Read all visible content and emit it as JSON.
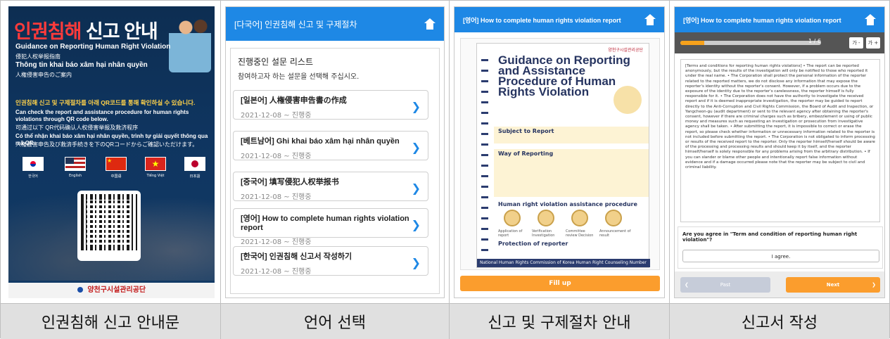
{
  "captions": [
    "인권침해 신고 안내문",
    "언어 선택",
    "신고 및 구제절차 안내",
    "신고서 작성"
  ],
  "poster": {
    "title_red": "인권침해",
    "title_white": "신고 안내",
    "en_title": "Guidance on Reporting Human Right Violation",
    "jp_title": "侵犯人权举报指南",
    "vi_title": "Thông tin khai báo xâm hại nhân quyền",
    "cn_title": "人権侵害申告のご案内",
    "qr_ko": "인권침해 신고 및 구제절차를 아래 QR코드를 통해 확인하실 수 있습니다.",
    "qr_en": "Can check the report and assistance procedure for human rights violations through QR code below.",
    "qr_cn": "可通过以下 QR代码确认人权侵害举报及救济程序",
    "qr_vi": "Có thể nhận khai báo xâm hại nhân quyền, trình tự giải quyết thông qua mã QR",
    "qr_jp": "人権侵害申告及び救済手続きを下のQRコードからご確認いただけます。",
    "flags": [
      "한국어",
      "English",
      "中国语",
      "Tiếng Việt",
      "日本語"
    ],
    "footer": "양천구시설관리공단"
  },
  "lang_select": {
    "header": "[다국어] 인권침해 신고 및 구제절차",
    "line1": "진행중인 설문 리스트",
    "line2": "참여하고자 하는 설문을 선택해 주십시오.",
    "surveys": [
      {
        "title": "[일본어] 人権侵害申告書の作成",
        "date": "2021-12-08 ~ 진행중"
      },
      {
        "title": "[베트남어] Ghi khai báo xâm hại nhân quyền",
        "date": "2021-12-08 ~ 진행중"
      },
      {
        "title": "[중국어] 填写侵犯人权举报书",
        "date": "2021-12-08 ~ 진행중"
      },
      {
        "title": "[영어] How to complete human rights violation report",
        "date": "2021-12-08 ~ 진행중"
      },
      {
        "title": "[한국어] 인권침해 신고서 작성하기",
        "date": "2021-12-08 ~ 진행중"
      }
    ]
  },
  "guide": {
    "header": "[영어] How to complete human rights violation report",
    "org": "양천구시설관리공단",
    "doc_title": "Guidance on Reporting and Assistance Procedure of Human Rights Violation",
    "subject": "Subject to Report",
    "way": "Way of Reporting",
    "assist": "Human right violation assistance procedure",
    "steps": [
      "Application of report",
      "Verification Investigation",
      "Committee review Decision",
      "Announcement of result"
    ],
    "protection": "Protection of reporter",
    "footer": "National Human Rights Commission of Korea Human Right Counseling Number Without area code 1331",
    "fill_up": "Fill up"
  },
  "form": {
    "header": "[영어] How to complete human rights violation report",
    "progress": "1 / 6",
    "progress_fraction": 0.17,
    "font_minus": "가 -",
    "font_plus": "가 +",
    "terms": "[Terms and conditions for reporting human rights violations] • The report can be reported anonymously, but the results of the investigation will only be notified to those who reported it under the real name. • The Corporation shall protect the personal information of the reporter related to the reported matters, we do not disclose any information that may expose the reporter's identity without the reporter's consent. However, if a problem occurs due to the exposure of the identity due to the reporter's carelessness, the reporter himself is fully responsible for it. • The Corporation does not have the authority to investigate the received report and if it is deemed inappropriate investigation, the reporter may be guided to report directly to the Anti-Corruption and Civil Rights Commission, the Board of Audit and Inspection, or Yangcheon-gu (audit department) or sent to the relevant agency after obtaining the reporter's consent, however if there are criminal charges such as bribery, embezzlement or using of public money and measures such as requesting an investigation or prosecution from investigative agency shall be taken. • After submitting the report, it is impossible to correct or erase the report, so please check whether information or unnecessary information related to the reporter is not included before submitting the report. • The Corporation is not obligated to inform processing or results of the received report to the reporter. Only the reporter himself/herself should be aware of the processing and processing results and should keep it by itself, and the reporter himself/herself is solely responsible for any problems arising from the arbitrary distribution. • If you can slander or blame other people and intentionally report false information without evidence and if a damage occurred please note that the reporter may be subject to civil and criminal liability.",
    "question": "Are you agree in \"Term and condition of reporting human right violation\"?",
    "agree": "I agree.",
    "past": "Past",
    "next": "Next"
  }
}
